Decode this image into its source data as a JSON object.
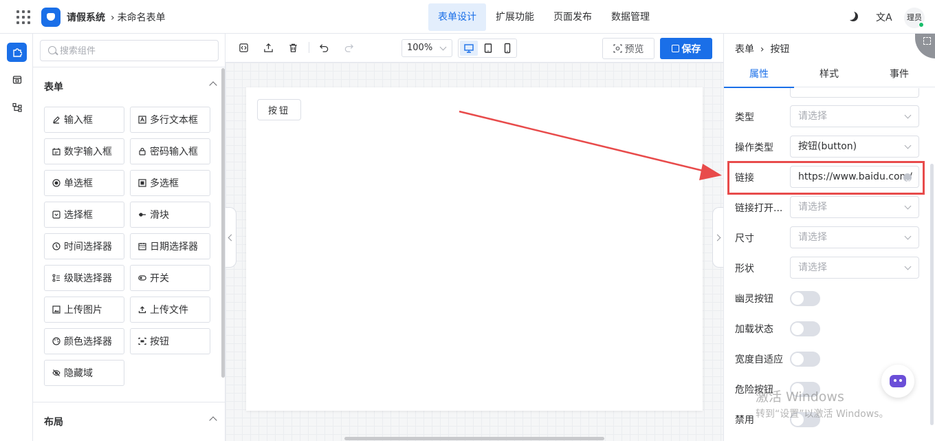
{
  "header": {
    "app_title": "请假系统",
    "breadcrumb": "未命名表单",
    "tabs": [
      {
        "label": "表单设计",
        "active": true
      },
      {
        "label": "扩展功能",
        "active": false
      },
      {
        "label": "页面发布",
        "active": false
      },
      {
        "label": "数据管理",
        "active": false
      }
    ],
    "translate_glyph": "文A",
    "avatar_text": "理员"
  },
  "components": {
    "search_placeholder": "搜索组件",
    "section_form": "表单",
    "items": [
      {
        "label": "输入框",
        "icon": "edit-icon"
      },
      {
        "label": "多行文本框",
        "icon": "textarea-icon"
      },
      {
        "label": "数字输入框",
        "icon": "number-icon"
      },
      {
        "label": "密码输入框",
        "icon": "lock-icon"
      },
      {
        "label": "单选框",
        "icon": "radio-icon"
      },
      {
        "label": "多选框",
        "icon": "checkbox-icon"
      },
      {
        "label": "选择框",
        "icon": "select-icon"
      },
      {
        "label": "滑块",
        "icon": "slider-icon"
      },
      {
        "label": "时间选择器",
        "icon": "clock-icon"
      },
      {
        "label": "日期选择器",
        "icon": "calendar-icon"
      },
      {
        "label": "级联选择器",
        "icon": "cascader-icon"
      },
      {
        "label": "开关",
        "icon": "switch-icon"
      },
      {
        "label": "上传图片",
        "icon": "image-icon"
      },
      {
        "label": "上传文件",
        "icon": "upload-icon"
      },
      {
        "label": "颜色选择器",
        "icon": "palette-icon"
      },
      {
        "label": "按钮",
        "icon": "button-icon"
      },
      {
        "label": "隐藏域",
        "icon": "eye-off-icon"
      }
    ],
    "section_layout": "布局"
  },
  "toolbar": {
    "zoom": "100%",
    "preview_label": "预览",
    "save_label": "保存"
  },
  "canvas": {
    "button_label": "按钮"
  },
  "properties": {
    "breadcrumb_root": "表单",
    "breadcrumb_current": "按钮",
    "tabs": [
      {
        "label": "属性",
        "active": true
      },
      {
        "label": "样式",
        "active": false
      },
      {
        "label": "事件",
        "active": false
      }
    ],
    "rows": [
      {
        "label": "类型",
        "kind": "select",
        "value": "",
        "placeholder": "请选择"
      },
      {
        "label": "操作类型",
        "kind": "select",
        "value": "按钮(button)",
        "placeholder": ""
      },
      {
        "label": "链接",
        "kind": "input",
        "value": "https://www.baidu.com/",
        "placeholder": ""
      },
      {
        "label": "链接打开...",
        "kind": "select",
        "value": "",
        "placeholder": "请选择"
      },
      {
        "label": "尺寸",
        "kind": "select",
        "value": "",
        "placeholder": "请选择"
      },
      {
        "label": "形状",
        "kind": "select",
        "value": "",
        "placeholder": "请选择"
      },
      {
        "label": "幽灵按钮",
        "kind": "switch",
        "value": false
      },
      {
        "label": "加载状态",
        "kind": "switch",
        "value": false
      },
      {
        "label": "宽度自适应",
        "kind": "switch",
        "value": false
      },
      {
        "label": "危险按钮",
        "kind": "switch",
        "value": false
      },
      {
        "label": "禁用",
        "kind": "switch",
        "value": false
      }
    ]
  },
  "watermark": {
    "title": "激活 Windows",
    "subtitle": "转到“设置”以激活 Windows。"
  },
  "colors": {
    "accent": "#1a6fe8",
    "annotation": "#e84b4b"
  }
}
